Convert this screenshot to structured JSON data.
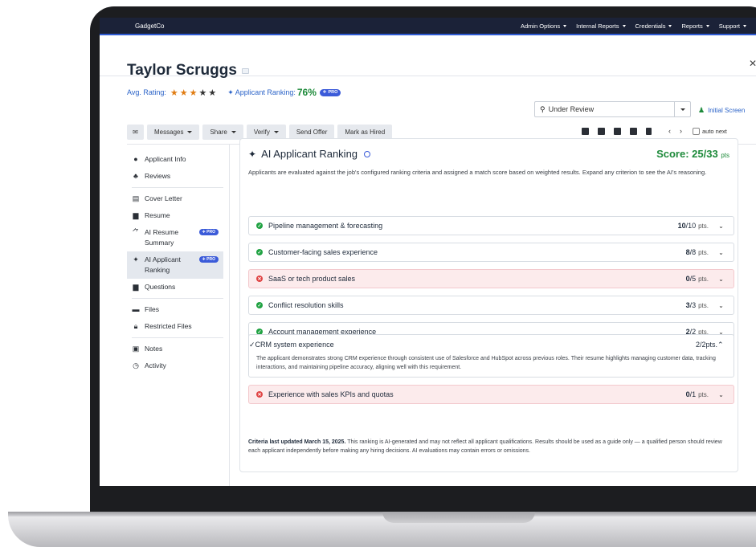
{
  "topnav": {
    "brand": "GadgetCo",
    "items": [
      "Admin Options",
      "Internal Reports",
      "Credentials",
      "Reports",
      "Support"
    ]
  },
  "candidate": {
    "name": "Taylor Scruggs",
    "avg_rating_label": "Avg. Rating:",
    "rating": 3,
    "rating_max": 5,
    "ranking_label": "Applicant Ranking:",
    "ranking_value": "76%",
    "pro_label": "PRO"
  },
  "status": {
    "value": "Under Review",
    "initial_screen": "Initial Screen"
  },
  "toolbar": {
    "messages": "Messages",
    "share": "Share",
    "verify": "Verify",
    "send_offer": "Send Offer",
    "mark_hired": "Mark as Hired",
    "auto_next": "auto next"
  },
  "sidebar": {
    "items": [
      {
        "label": "Applicant Info",
        "icon": "user-circle-icon"
      },
      {
        "label": "Reviews",
        "icon": "reviews-icon"
      },
      {
        "label": "Cover Letter",
        "icon": "document-icon"
      },
      {
        "label": "Resume",
        "icon": "file-icon"
      },
      {
        "label": "AI Resume Summary",
        "icon": "ai-chart-icon",
        "pro": "PRO"
      },
      {
        "label": "AI Applicant Ranking",
        "icon": "sparkle-icon",
        "pro": "PRO"
      },
      {
        "label": "Questions",
        "icon": "file-icon"
      },
      {
        "label": "Files",
        "icon": "folder-icon"
      },
      {
        "label": "Restricted Files",
        "icon": "lock-icon"
      },
      {
        "label": "Notes",
        "icon": "clipboard-icon"
      },
      {
        "label": "Activity",
        "icon": "clock-icon"
      }
    ]
  },
  "ranking": {
    "title": "AI Applicant Ranking",
    "score_label": "Score: 25/33",
    "score_unit": "pts",
    "description": "Applicants are evaluated against the job's configured ranking criteria and assigned a match score based on weighted results. Expand any criterion to see the AI's reasoning.",
    "pts_unit": "pts.",
    "criteria": [
      {
        "label": "Pipeline management & forecasting",
        "score": "10",
        "max": "/10",
        "passed": true
      },
      {
        "label": "Customer-facing sales experience",
        "score": "8",
        "max": "/8",
        "passed": true
      },
      {
        "label": "SaaS or tech product sales",
        "score": "0",
        "max": "/5",
        "passed": false
      },
      {
        "label": "Conflict resolution skills",
        "score": "3",
        "max": "/3",
        "passed": true
      },
      {
        "label": "Account management experience",
        "score": "2",
        "max": "/2",
        "passed": true
      },
      {
        "label": "CRM system experience",
        "score": "2",
        "max": "/2",
        "passed": true,
        "expanded": true,
        "reasoning": "The applicant demonstrates strong CRM experience through consistent use of Salesforce and HubSpot across previous roles. Their resume highlights managing customer data, tracking interactions, and maintaining pipeline accuracy, aligning well with this requirement."
      },
      {
        "label": "Experience with sales KPIs and quotas",
        "score": "0",
        "max": "/1",
        "passed": false
      }
    ],
    "footnote_bold": "Criteria last updated March 15, 2025.",
    "footnote": " This ranking is AI-generated and may not reflect all applicant qualifications. Results should be used as a guide only — a qualified person should review each applicant independently before making any hiring decisions. AI evaluations may contain errors or omissions."
  }
}
